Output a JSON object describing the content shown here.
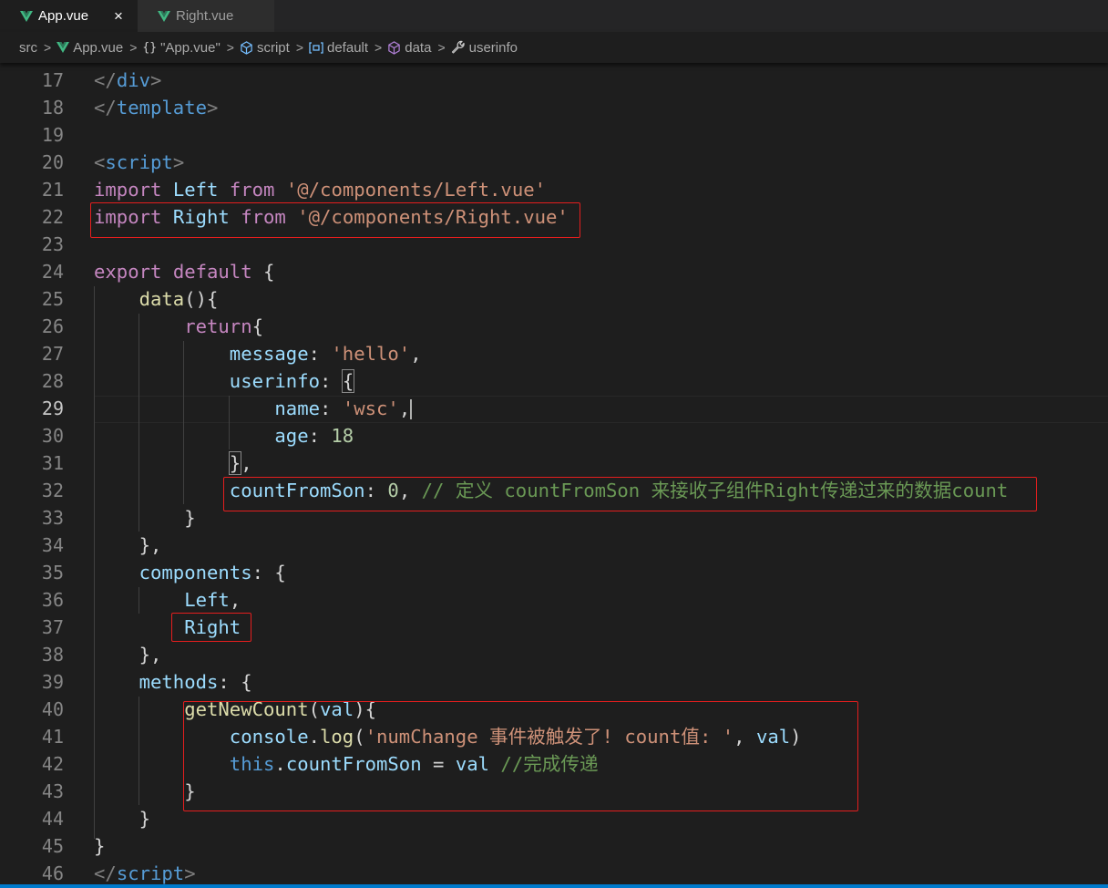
{
  "tabs": [
    {
      "label": "App.vue",
      "active": true,
      "close": "×"
    },
    {
      "label": "Right.vue",
      "active": false
    }
  ],
  "breadcrumb": [
    {
      "label": "src",
      "icon": ""
    },
    {
      "label": "App.vue",
      "icon": "vue-icon"
    },
    {
      "label": "\"App.vue\"",
      "icon": "braces-icon"
    },
    {
      "label": "script",
      "icon": "cube-icon"
    },
    {
      "label": "default",
      "icon": "variable-icon"
    },
    {
      "label": "data",
      "icon": "method-icon"
    },
    {
      "label": "userinfo",
      "icon": "wrench-icon"
    }
  ],
  "editor": {
    "current_line": 29,
    "lines": [
      {
        "n": 17,
        "tokens": [
          [
            "tg",
            "</"
          ],
          [
            "tn",
            "div"
          ],
          [
            "tg",
            ">"
          ]
        ]
      },
      {
        "n": 18,
        "tokens": [
          [
            "tg",
            "</"
          ],
          [
            "tn",
            "template"
          ],
          [
            "tg",
            ">"
          ]
        ]
      },
      {
        "n": 19,
        "tokens": []
      },
      {
        "n": 20,
        "tokens": [
          [
            "tg",
            "<"
          ],
          [
            "tn",
            "script"
          ],
          [
            "tg",
            ">"
          ]
        ]
      },
      {
        "n": 21,
        "tokens": [
          [
            "kw",
            "import"
          ],
          [
            "pn",
            " "
          ],
          [
            "id",
            "Left"
          ],
          [
            "pn",
            " "
          ],
          [
            "kw",
            "from"
          ],
          [
            "pn",
            " "
          ],
          [
            "str",
            "'@/components/Left.vue'"
          ]
        ]
      },
      {
        "n": 22,
        "tokens": [
          [
            "kw",
            "import"
          ],
          [
            "pn",
            " "
          ],
          [
            "id",
            "Right"
          ],
          [
            "pn",
            " "
          ],
          [
            "kw",
            "from"
          ],
          [
            "pn",
            " "
          ],
          [
            "str",
            "'@/components/Right.vue'"
          ]
        ]
      },
      {
        "n": 23,
        "tokens": []
      },
      {
        "n": 24,
        "tokens": [
          [
            "kw",
            "export"
          ],
          [
            "pn",
            " "
          ],
          [
            "kw",
            "default"
          ],
          [
            "pn",
            " "
          ],
          [
            "br",
            "{"
          ]
        ]
      },
      {
        "n": 25,
        "tokens": [
          [
            "pn",
            "    "
          ],
          [
            "fn",
            "data"
          ],
          [
            "br",
            "()"
          ],
          [
            "br",
            "{"
          ]
        ]
      },
      {
        "n": 26,
        "tokens": [
          [
            "pn",
            "        "
          ],
          [
            "kw",
            "return"
          ],
          [
            "br",
            "{"
          ]
        ]
      },
      {
        "n": 27,
        "tokens": [
          [
            "pn",
            "            "
          ],
          [
            "id",
            "message"
          ],
          [
            "pn",
            ": "
          ],
          [
            "str",
            "'hello'"
          ],
          [
            "pn",
            ","
          ]
        ]
      },
      {
        "n": 28,
        "tokens": [
          [
            "pn",
            "            "
          ],
          [
            "id",
            "userinfo"
          ],
          [
            "pn",
            ": "
          ],
          [
            "brm",
            "{"
          ]
        ]
      },
      {
        "n": 29,
        "tokens": [
          [
            "pn",
            "                "
          ],
          [
            "id",
            "name"
          ],
          [
            "pn",
            ": "
          ],
          [
            "str",
            "'wsc'"
          ],
          [
            "pn",
            ","
          ]
        ]
      },
      {
        "n": 30,
        "tokens": [
          [
            "pn",
            "                "
          ],
          [
            "id",
            "age"
          ],
          [
            "pn",
            ": "
          ],
          [
            "num",
            "18"
          ]
        ]
      },
      {
        "n": 31,
        "tokens": [
          [
            "pn",
            "            "
          ],
          [
            "brm",
            "}"
          ],
          [
            "pn",
            ","
          ]
        ]
      },
      {
        "n": 32,
        "tokens": [
          [
            "pn",
            "            "
          ],
          [
            "id",
            "countFromSon"
          ],
          [
            "pn",
            ": "
          ],
          [
            "num",
            "0"
          ],
          [
            "pn",
            ", "
          ],
          [
            "cm",
            "// 定义 countFromSon 来接收子组件Right传递过来的数据count"
          ]
        ]
      },
      {
        "n": 33,
        "tokens": [
          [
            "pn",
            "        "
          ],
          [
            "br",
            "}"
          ]
        ]
      },
      {
        "n": 34,
        "tokens": [
          [
            "pn",
            "    "
          ],
          [
            "br",
            "}"
          ],
          [
            "pn",
            ","
          ]
        ]
      },
      {
        "n": 35,
        "tokens": [
          [
            "pn",
            "    "
          ],
          [
            "id",
            "components"
          ],
          [
            "pn",
            ": "
          ],
          [
            "br",
            "{"
          ]
        ]
      },
      {
        "n": 36,
        "tokens": [
          [
            "pn",
            "        "
          ],
          [
            "id",
            "Left"
          ],
          [
            "pn",
            ","
          ]
        ]
      },
      {
        "n": 37,
        "tokens": [
          [
            "pn",
            "        "
          ],
          [
            "id",
            "Right"
          ]
        ]
      },
      {
        "n": 38,
        "tokens": [
          [
            "pn",
            "    "
          ],
          [
            "br",
            "}"
          ],
          [
            "pn",
            ","
          ]
        ]
      },
      {
        "n": 39,
        "tokens": [
          [
            "pn",
            "    "
          ],
          [
            "id",
            "methods"
          ],
          [
            "pn",
            ": "
          ],
          [
            "br",
            "{"
          ]
        ]
      },
      {
        "n": 40,
        "tokens": [
          [
            "pn",
            "        "
          ],
          [
            "fn",
            "getNewCount"
          ],
          [
            "br",
            "("
          ],
          [
            "id",
            "val"
          ],
          [
            "br",
            ")"
          ],
          [
            "br",
            "{"
          ]
        ]
      },
      {
        "n": 41,
        "tokens": [
          [
            "pn",
            "            "
          ],
          [
            "id",
            "console"
          ],
          [
            "pn",
            "."
          ],
          [
            "fn",
            "log"
          ],
          [
            "br",
            "("
          ],
          [
            "str",
            "'numChange 事件被触发了! count值: '"
          ],
          [
            "pn",
            ", "
          ],
          [
            "id",
            "val"
          ],
          [
            "br",
            ")"
          ]
        ]
      },
      {
        "n": 42,
        "tokens": [
          [
            "pn",
            "            "
          ],
          [
            "tn",
            "this"
          ],
          [
            "pn",
            "."
          ],
          [
            "id",
            "countFromSon"
          ],
          [
            "pn",
            " = "
          ],
          [
            "id",
            "val"
          ],
          [
            "pn",
            " "
          ],
          [
            "cm",
            "//完成传递"
          ]
        ]
      },
      {
        "n": 43,
        "tokens": [
          [
            "pn",
            "        "
          ],
          [
            "br",
            "}"
          ]
        ]
      },
      {
        "n": 44,
        "tokens": [
          [
            "pn",
            "    "
          ],
          [
            "br",
            "}"
          ]
        ]
      },
      {
        "n": 45,
        "tokens": [
          [
            "br",
            "}"
          ]
        ]
      },
      {
        "n": 46,
        "tokens": [
          [
            "tg",
            "</"
          ],
          [
            "tn",
            "script"
          ],
          [
            "tg",
            ">"
          ]
        ]
      }
    ]
  },
  "colors": {
    "background": "#1e1e1e",
    "highlight_box": "#e41e1e",
    "vue_logo": "#41b883",
    "accent_bar": "#007acc"
  }
}
